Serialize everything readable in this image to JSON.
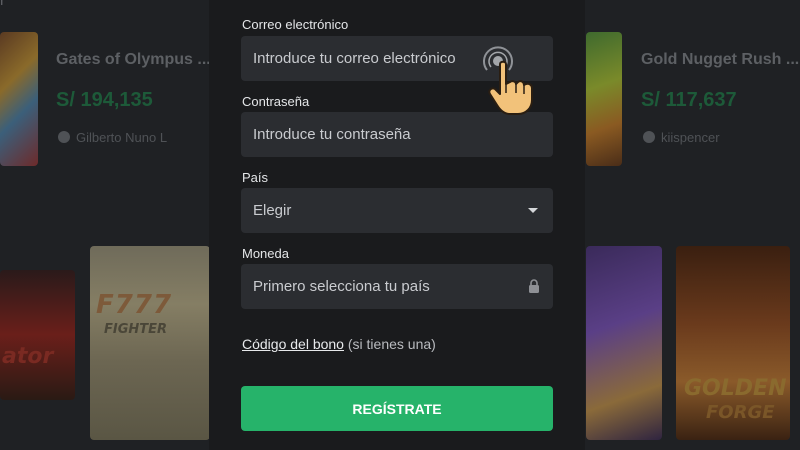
{
  "background": {
    "header_partial": "r",
    "cards": [
      {
        "title": "Gates of Olympus ...",
        "amount": "S/ 194,135",
        "user": "Gilberto Nuno L"
      },
      {
        "title": "Gold Nugget Rush ...",
        "amount": "S/ 117,637",
        "user": "kiispencer"
      }
    ],
    "art": {
      "f7_logo": "F777",
      "f7_sub": "FIGHTER",
      "golden": "GOLDEN",
      "forge": "FORGE",
      "l2": "ator"
    }
  },
  "form": {
    "email": {
      "label": "Correo electrónico",
      "placeholder": "Introduce tu correo electrónico"
    },
    "password": {
      "label": "Contraseña",
      "placeholder": "Introduce tu contraseña"
    },
    "country": {
      "label": "País",
      "value": "Elegir"
    },
    "currency": {
      "label": "Moneda",
      "placeholder": "Primero selecciona tu país"
    },
    "bonus": {
      "link": "Código del bono",
      "suffix": " (si tienes una)"
    },
    "submit_label": "REGÍSTRATE"
  },
  "colors": {
    "accent_green": "#26b36a",
    "field_bg": "#2b2d31",
    "modal_bg": "#1a1b1d",
    "amount_green_dimmed": "#1d5a39"
  },
  "icons": {
    "caret": "chevron-down-icon",
    "lock": "lock-icon",
    "tap": "pointing-hand-icon",
    "user": "user-icon"
  }
}
